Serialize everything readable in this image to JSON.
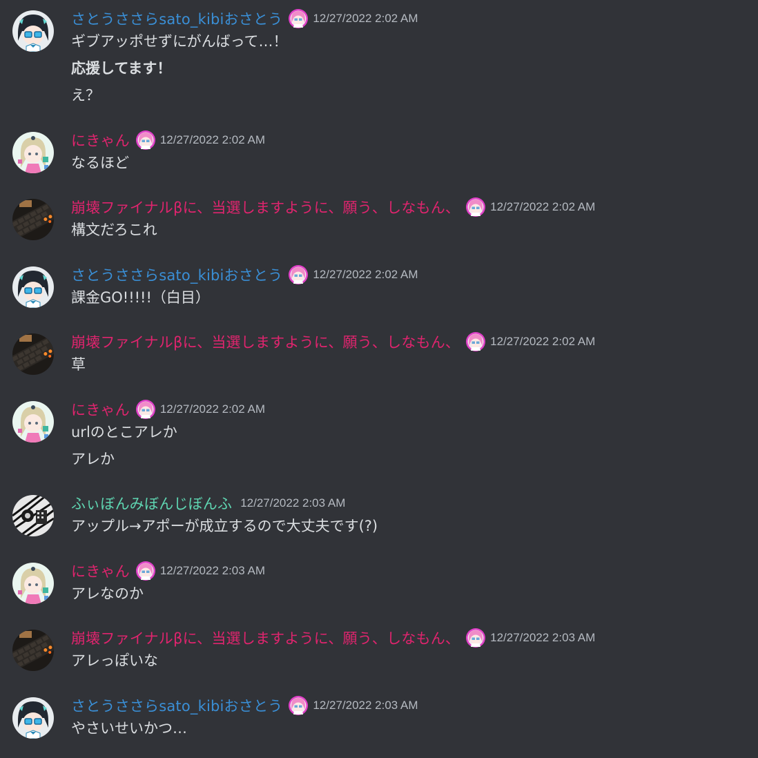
{
  "colors": {
    "background": "#313338",
    "text": "#dbdee1",
    "timestamp": "#b5bac1",
    "user_blue": "#3a8fd6",
    "user_pink": "#e0246e",
    "user_teal": "#5fd6b2",
    "badge_ring": "#e040c8"
  },
  "messages": [
    {
      "username": "さとうささらsato_kibiおさとう",
      "user_color": "blue",
      "avatar": "anime-avatar-sato",
      "has_badge": true,
      "timestamp": "12/27/2022 2:02 AM",
      "lines": [
        "ギブアッポせずにがんばって…！",
        "応援してます！",
        "え？"
      ]
    },
    {
      "username": "にきゃん",
      "user_color": "pink",
      "avatar": "anime-avatar-nikyan",
      "has_badge": true,
      "timestamp": "12/27/2022 2:02 AM",
      "lines": [
        "なるほど"
      ]
    },
    {
      "username": "崩壊ファイナルβに、当選しますように、願う、しなもん、",
      "user_color": "pink",
      "avatar": "keyboard-avatar",
      "has_badge": true,
      "timestamp": "12/27/2022 2:02 AM",
      "lines": [
        "構文だろこれ"
      ]
    },
    {
      "username": "さとうささらsato_kibiおさとう",
      "user_color": "blue",
      "avatar": "anime-avatar-sato",
      "has_badge": true,
      "timestamp": "12/27/2022 2:02 AM",
      "lines": [
        "課金GO!!!!!（白目）"
      ]
    },
    {
      "username": "崩壊ファイナルβに、当選しますように、願う、しなもん、",
      "user_color": "pink",
      "avatar": "keyboard-avatar",
      "has_badge": true,
      "timestamp": "12/27/2022 2:02 AM",
      "lines": [
        "草"
      ]
    },
    {
      "username": "にきゃん",
      "user_color": "pink",
      "avatar": "anime-avatar-nikyan",
      "has_badge": true,
      "timestamp": "12/27/2022 2:02 AM",
      "lines": [
        "urlのとこアレか",
        "アレか"
      ]
    },
    {
      "username": "ふぃぼんみぼんじぼんふ",
      "user_color": "teal",
      "avatar": "monochrome-avatar",
      "has_badge": false,
      "timestamp": "12/27/2022 2:03 AM",
      "lines": [
        "アップル→アポーが成立するので大丈夫です(?)"
      ]
    },
    {
      "username": "にきゃん",
      "user_color": "pink",
      "avatar": "anime-avatar-nikyan",
      "has_badge": true,
      "timestamp": "12/27/2022 2:03 AM",
      "lines": [
        "アレなのか"
      ]
    },
    {
      "username": "崩壊ファイナルβに、当選しますように、願う、しなもん、",
      "user_color": "pink",
      "avatar": "keyboard-avatar",
      "has_badge": true,
      "timestamp": "12/27/2022 2:03 AM",
      "lines": [
        "アレっぽいな"
      ]
    },
    {
      "username": "さとうささらsato_kibiおさとう",
      "user_color": "blue",
      "avatar": "anime-avatar-sato",
      "has_badge": true,
      "timestamp": "12/27/2022 2:03 AM",
      "lines": [
        "やさいせいかつ…"
      ]
    }
  ]
}
